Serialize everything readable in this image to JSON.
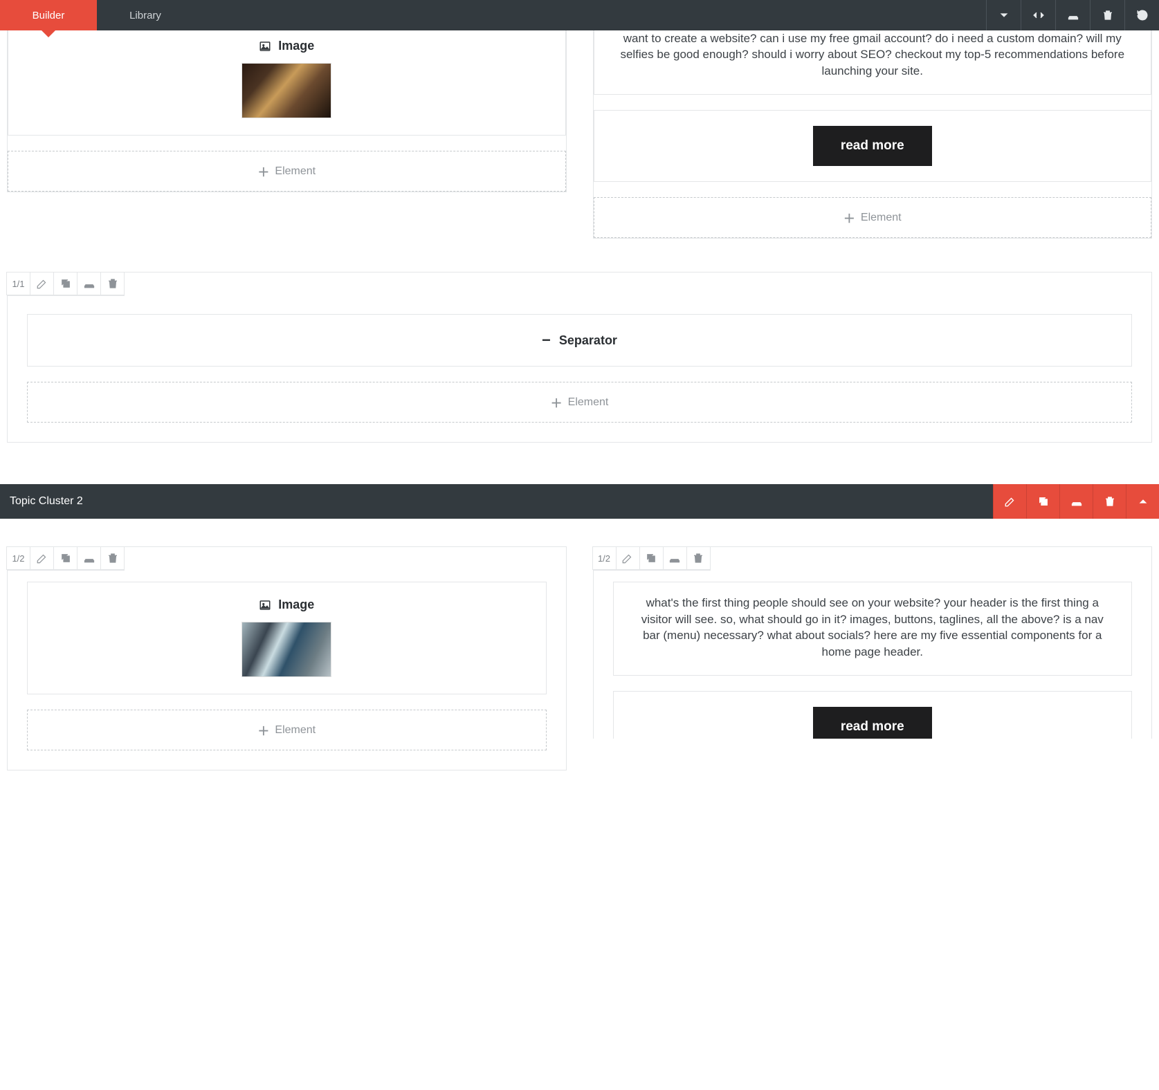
{
  "nav": {
    "builder": "Builder",
    "library": "Library"
  },
  "row1": {
    "left": {
      "image_label": "Image",
      "add_element": "Element"
    },
    "right": {
      "text": "want to create a website? can i use my free gmail account? do i need a custom domain? will my selfies be good enough? should i worry about SEO? checkout my top-5 recommendations before launching your site.",
      "cta": "read more",
      "add_element": "Element"
    }
  },
  "sep_row": {
    "col_label": "1/1",
    "separator_label": "Separator",
    "add_element": "Element"
  },
  "section2": {
    "title": "Topic Cluster 2",
    "left": {
      "col_label": "1/2",
      "image_label": "Image",
      "add_element": "Element"
    },
    "right": {
      "col_label": "1/2",
      "text": "what's the first thing people should see on your website? your header is the first thing a visitor will see. so, what should go in it? images, buttons, taglines, all the above? is a nav bar (menu) necessary? what about socials? here are my five essential components for a home page header.",
      "cta": "read more"
    }
  }
}
